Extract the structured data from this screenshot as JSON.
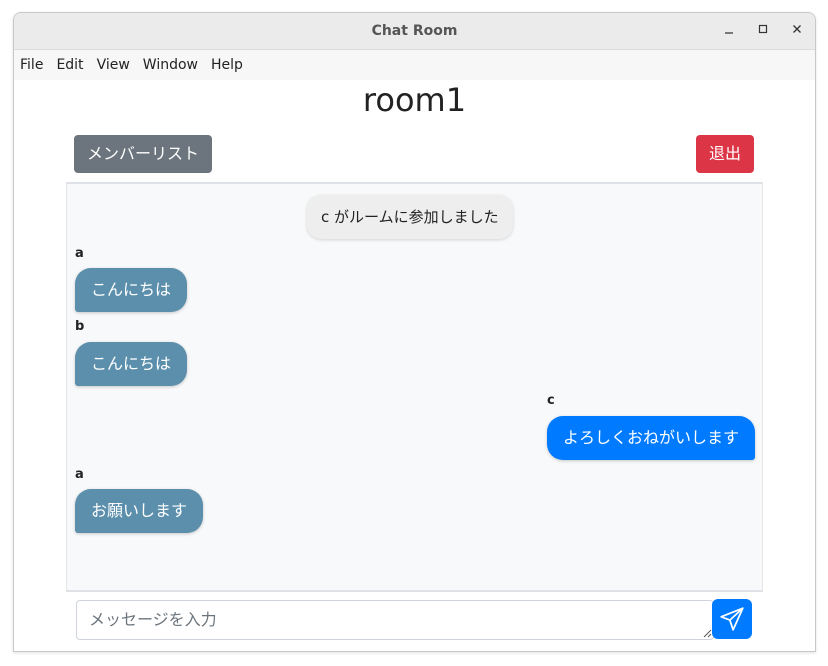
{
  "window": {
    "title": "Chat Room"
  },
  "menu": [
    "File",
    "Edit",
    "View",
    "Window",
    "Help"
  ],
  "room": {
    "name": "room1"
  },
  "toolbar": {
    "members_label": "メンバーリスト",
    "exit_label": "退出"
  },
  "system_message": "c がルームに参加しました",
  "messages": [
    {
      "sender": "a",
      "text": "こんにちは",
      "mine": false
    },
    {
      "sender": "b",
      "text": "こんにちは",
      "mine": false
    },
    {
      "sender": "c",
      "text": "よろしくおねがいします",
      "mine": true
    },
    {
      "sender": "a",
      "text": "お願いします",
      "mine": false
    }
  ],
  "composer": {
    "placeholder": "メッセージを入力",
    "value": ""
  },
  "colors": {
    "members_button": "#6c757d",
    "exit_button": "#dc3545",
    "other_bubble": "#5b8fac",
    "own_bubble": "#007bff",
    "send_button": "#007bff"
  },
  "icons": {
    "minimize": "minimize-icon",
    "maximize": "maximize-icon",
    "close": "close-icon",
    "send": "paper-plane-icon"
  }
}
